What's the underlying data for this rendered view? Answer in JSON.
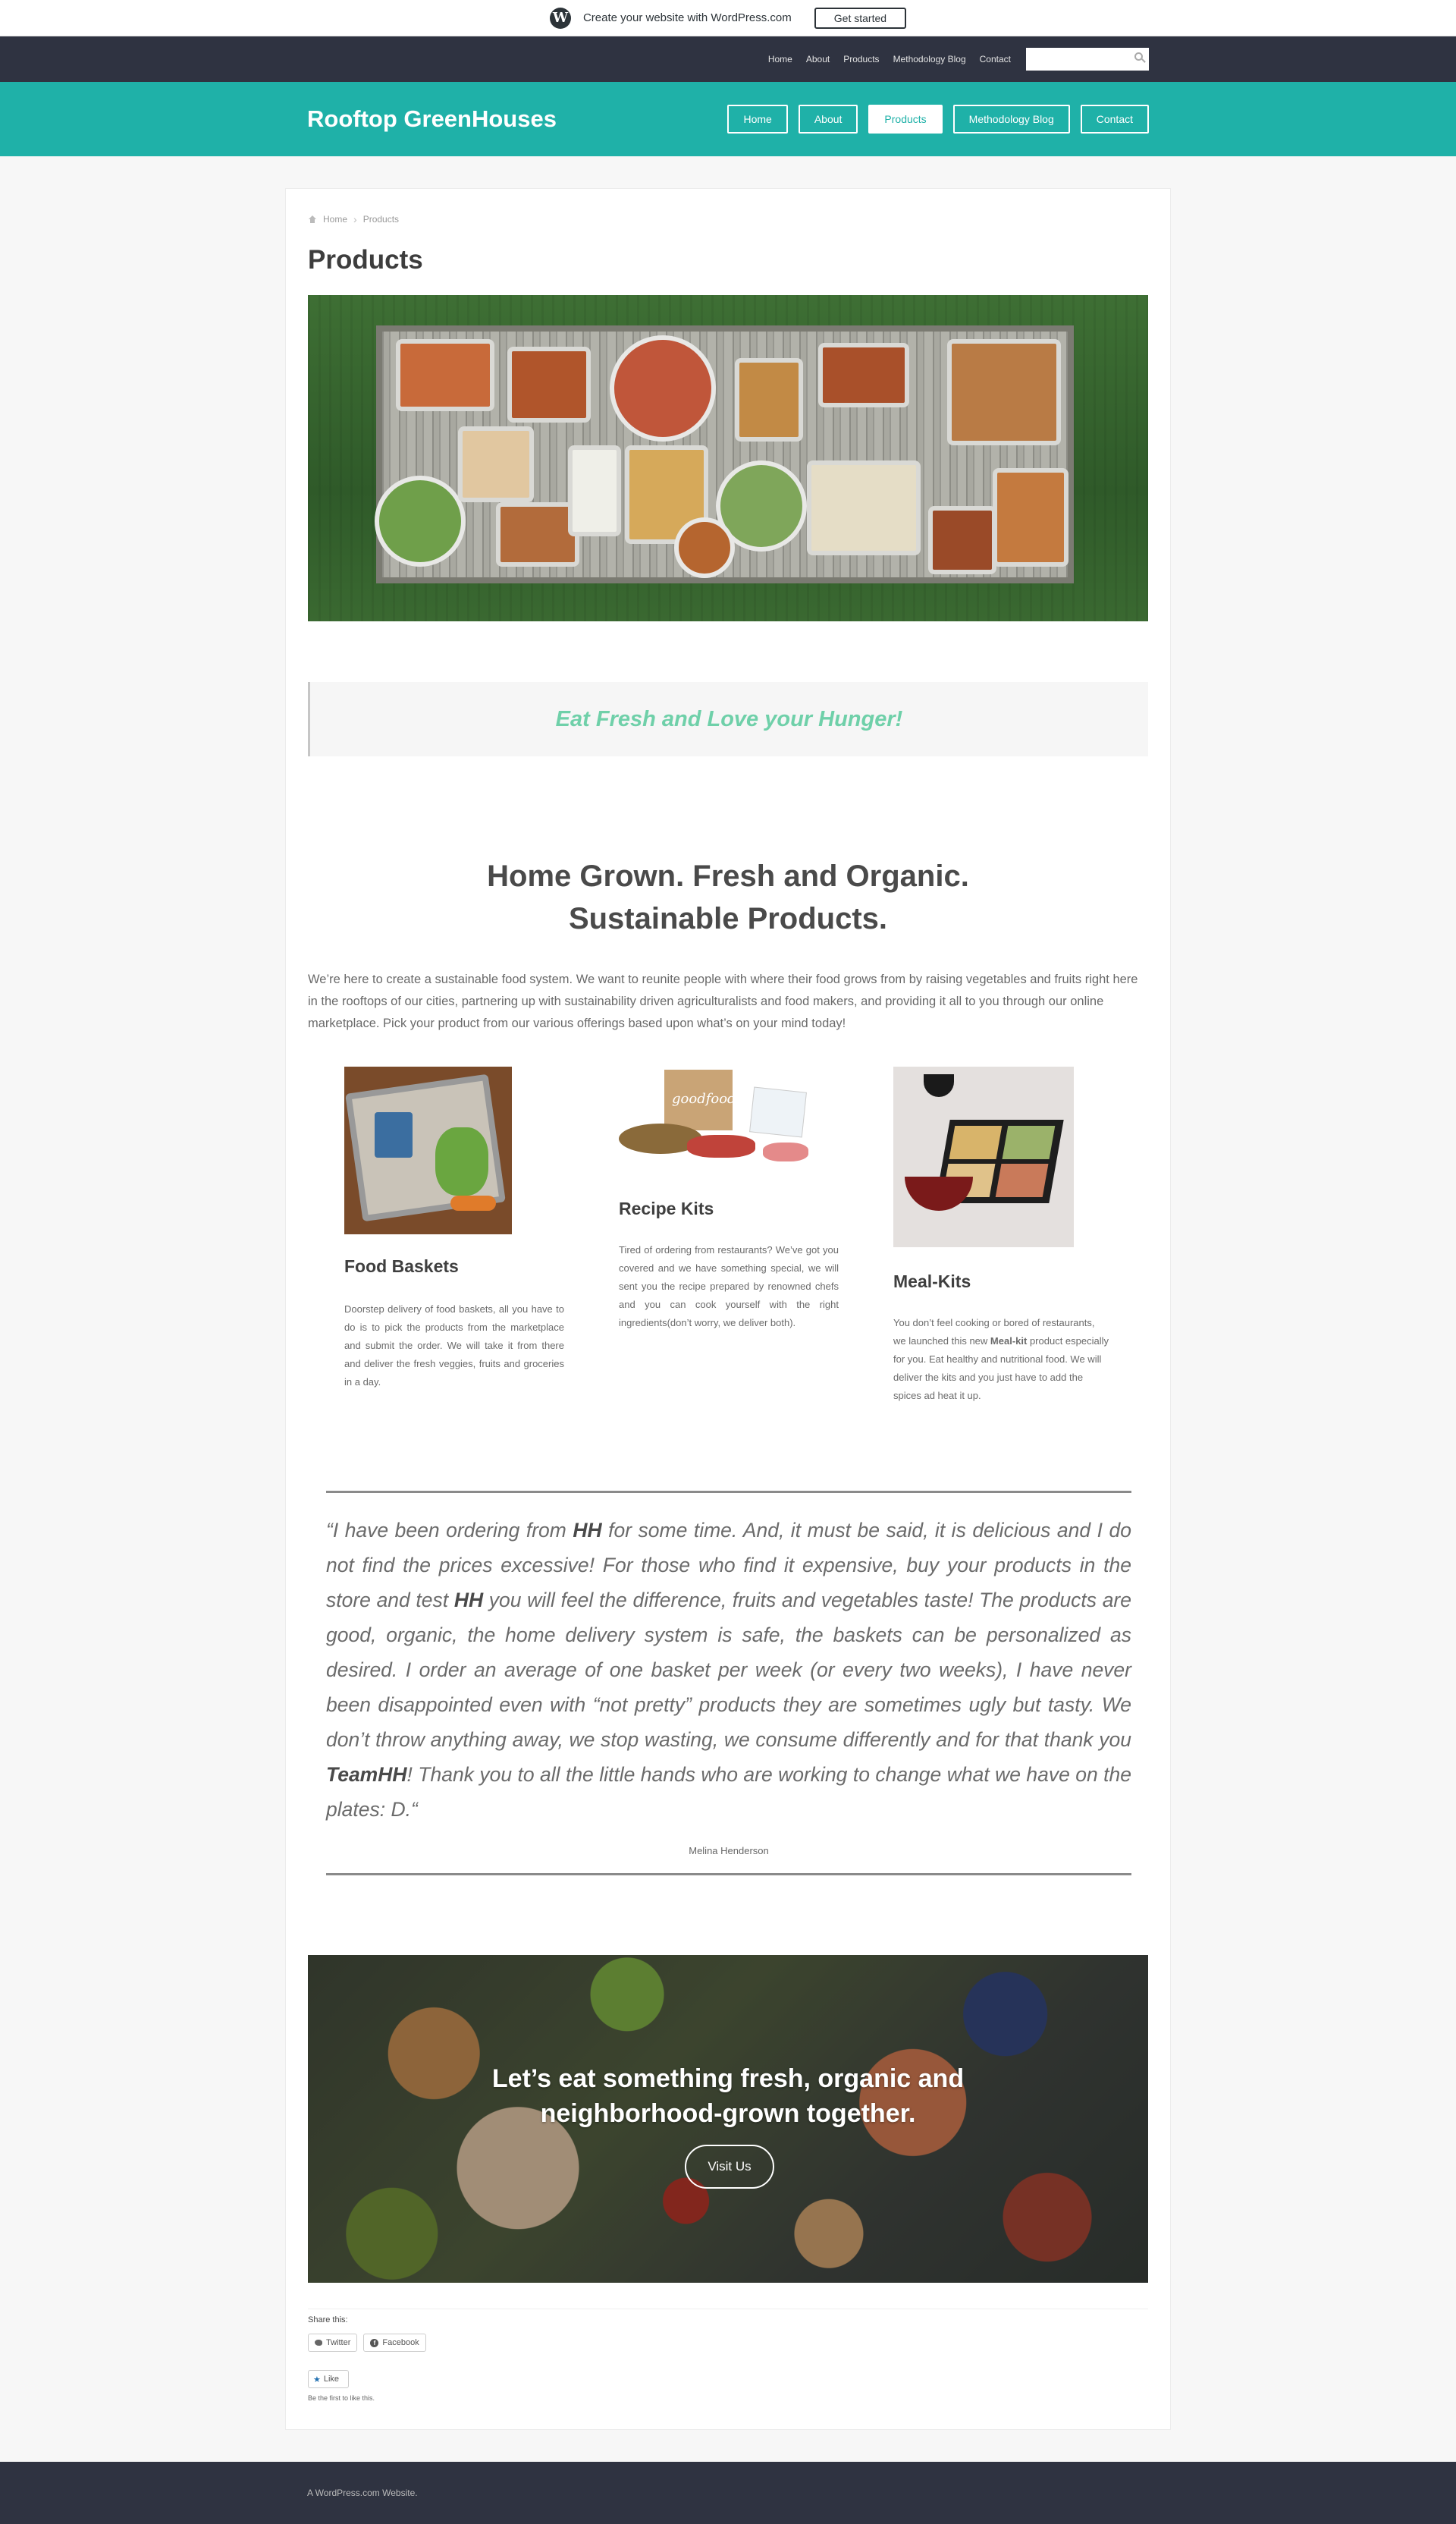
{
  "wpbar": {
    "text": "Create your website with WordPress.com",
    "button": "Get started",
    "logo_icon": "wordpress-logo-icon"
  },
  "topnav": {
    "items": [
      "Home",
      "About",
      "Products",
      "Methodology Blog",
      "Contact"
    ],
    "search_placeholder": ""
  },
  "header": {
    "site_title": "Rooftop GreenHouses",
    "nav": [
      "Home",
      "About",
      "Products",
      "Methodology Blog",
      "Contact"
    ],
    "active": "Products"
  },
  "breadcrumb": {
    "home": "Home",
    "current": "Products"
  },
  "page_title": "Products",
  "banner_quote": "Eat Fresh and Love your Hunger!",
  "section": {
    "heading_line1": "Home Grown. Fresh and Organic.",
    "heading_line2": "Sustainable Products.",
    "intro": "We’re here to create a sustainable food system. We want to reunite people with where their food grows from by raising vegetables and fruits right here in the rooftops of our cities, partnering up with sustainability driven agriculturalists and food makers, and providing it all to you through our online marketplace. Pick your product from our various offerings based upon what’s on your mind today!"
  },
  "products": [
    {
      "title": "Food Baskets",
      "text": "Doorstep delivery of food baskets, all you have to do is to pick the products from the marketplace and submit the order. We will take it from there and deliver the fresh veggies, fruits and groceries in a day."
    },
    {
      "title": "Recipe Kits",
      "text": "Tired of ordering from restaurants? We’ve got you covered and we have something special, we will sent you the recipe prepared by renowned chefs and you can cook yourself with the right ingredients(don’t worry, we deliver both).",
      "image_brand": "goodfood"
    },
    {
      "title": "Meal-Kits",
      "text_before": "You don’t feel cooking or bored of restaurants, we launched this new ",
      "text_bold": "Meal-kit",
      "text_after": " product especially for you. Eat healthy and nutritional food. We will deliver the kits and you just have to add the spices ad heat it up."
    }
  ],
  "testimonial": {
    "open_quote": "“",
    "p1": "I have been ordering from ",
    "b1": "HH",
    "p2": " for some time. And, it must be said, it is delicious and I do not find the prices excessive! For those who find it expensive, buy your products in the store and test ",
    "b2": "HH",
    "p3": " you will feel the difference, fruits and vegetables taste! The products are good, organic, the home delivery system is safe, the baskets can be personalized as desired. I order an average of one basket per week (or every two weeks), I have never been disappointed even with “not pretty” products they are sometimes ugly but tasty. We don’t throw anything away, we stop wasting, we consume differently and for that thank you ",
    "b3": "TeamHH",
    "p4": "! Thank you to all the little hands who are working to change what we have on the plates: D.",
    "close_quote": "“",
    "author": "Melina Henderson"
  },
  "cta": {
    "line1": "Let’s eat something fresh, organic and",
    "line2": "neighborhood-grown together.",
    "button": "Visit Us"
  },
  "share": {
    "label": "Share this:",
    "twitter": "Twitter",
    "facebook": "Facebook",
    "like": "Like",
    "like_note": "Be the first to like this."
  },
  "footer": {
    "text": "A WordPress.com Website."
  },
  "colors": {
    "teal": "#1fb1a8",
    "dark_nav": "#2f3341",
    "quote_green": "#6fd0a9"
  }
}
